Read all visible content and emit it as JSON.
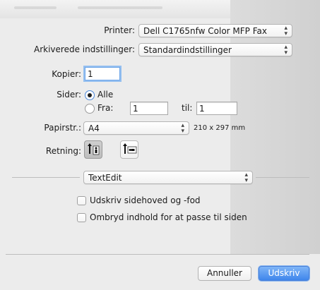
{
  "printer": {
    "label": "Printer:",
    "value": "Dell C1765nfw Color MFP Fax"
  },
  "presets": {
    "label": "Arkiverede indstillinger:",
    "value": "Standardindstillinger"
  },
  "copies": {
    "label": "Kopier:",
    "value": "1"
  },
  "pages": {
    "label": "Sider:",
    "all_label": "Alle",
    "from_label": "Fra:",
    "from_value": "1",
    "to_label": "til:",
    "to_value": "1",
    "selected": "all"
  },
  "paper": {
    "label": "Papirstr.:",
    "value": "A4",
    "dimensions": "210 x 297 mm"
  },
  "orientation": {
    "label": "Retning:",
    "selected": "portrait",
    "portrait_icon": "portrait-orientation-icon",
    "landscape_icon": "landscape-orientation-icon"
  },
  "app_section": {
    "value": "TextEdit"
  },
  "options": {
    "header_footer_label": "Udskriv sidehoved og -fod",
    "header_footer_checked": false,
    "wrap_label": "Ombryd indhold for at passe til siden",
    "wrap_checked": false
  },
  "buttons": {
    "cancel_label": "Annuller",
    "print_label": "Udskriv"
  },
  "colors": {
    "accent": "#3f86ec",
    "window_bg": "#ececec"
  }
}
